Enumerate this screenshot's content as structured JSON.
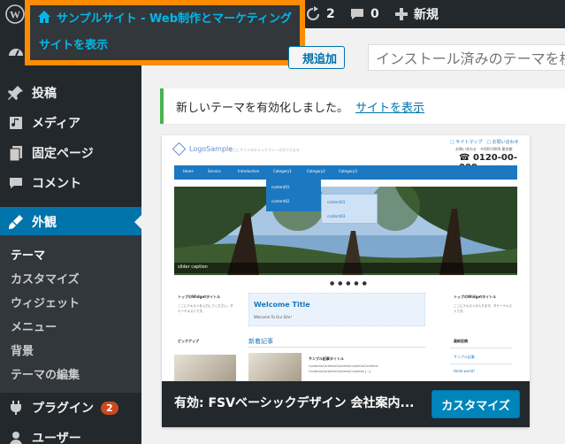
{
  "colors": {
    "admin_bg": "#23282d",
    "admin_submenu_bg": "#32373c",
    "accent": "#0073aa",
    "link": "#00b9eb",
    "highlight_border": "#ff8c00",
    "notice_border": "#46b450",
    "badge": "#ca4a1f"
  },
  "adminbar": {
    "site_name": "サンプルサイト - Web制作とマーケティング",
    "view_site": "サイトを表示",
    "updates_count": "2",
    "comments_count": "0",
    "new_label": "新規"
  },
  "sidebar": {
    "items": [
      {
        "label": "投稿",
        "icon": "pin-icon"
      },
      {
        "label": "メディア",
        "icon": "media-icon"
      },
      {
        "label": "固定ページ",
        "icon": "page-icon"
      },
      {
        "label": "コメント",
        "icon": "comment-icon"
      },
      {
        "label": "外観",
        "icon": "brush-icon"
      },
      {
        "label": "プラグイン",
        "icon": "plugin-icon",
        "badge": "2"
      },
      {
        "label": "ユーザー",
        "icon": "user-icon"
      }
    ],
    "submenu": [
      "テーマ",
      "カスタマイズ",
      "ウィジェット",
      "メニュー",
      "背景",
      "テーマの編集"
    ]
  },
  "main": {
    "add_new_label": "規追加",
    "search_placeholder": "インストール済みのテーマを検",
    "notice_text": "新しいテーマを有効化しました。",
    "notice_link": "サイトを表示"
  },
  "theme": {
    "active_name": "有効: FSVベーシックデザイン 会社案内...",
    "customize_label": "カスタマイズ",
    "preview": {
      "logo": "LogoSample",
      "tagline": "ここにサイトのキャッチフレーズが入ります",
      "toplinks": "□ サイトマップ　□ お問い合わせ",
      "address": "お問い合わせ　〒000-0000 東京都",
      "tel": "☎ 0120-00-000",
      "nav": [
        "Home",
        "Service",
        "Introduction",
        "Category1",
        "Category2",
        "Category3"
      ],
      "dropdown1": [
        "content01",
        "content02"
      ],
      "dropdown2": [
        "content01",
        "content03"
      ],
      "caption": "slider caption",
      "dots": "● ● ● ● ●",
      "left_head": "トップのWidgetタイトル",
      "left_body": "ここにテキストを入力してください。ダミーテキストです。",
      "pickup": "ピックアップ",
      "welcome_title": "Welcome Title",
      "welcome_sub": "Welcome To Our Site!",
      "news_title": "新着記事",
      "news_item": "サンプル記事タイトル",
      "news_body": "ContentsContentsContentsContentsContents ContentsContentsContentsContents [...]",
      "right_head": "トップのWidgetタイトル",
      "right_body": "ここにテキストが入ります。ダミーテキストです。",
      "right_sub": "最新投稿",
      "right_links": [
        "サンプル記事",
        "Hello world!"
      ]
    }
  }
}
